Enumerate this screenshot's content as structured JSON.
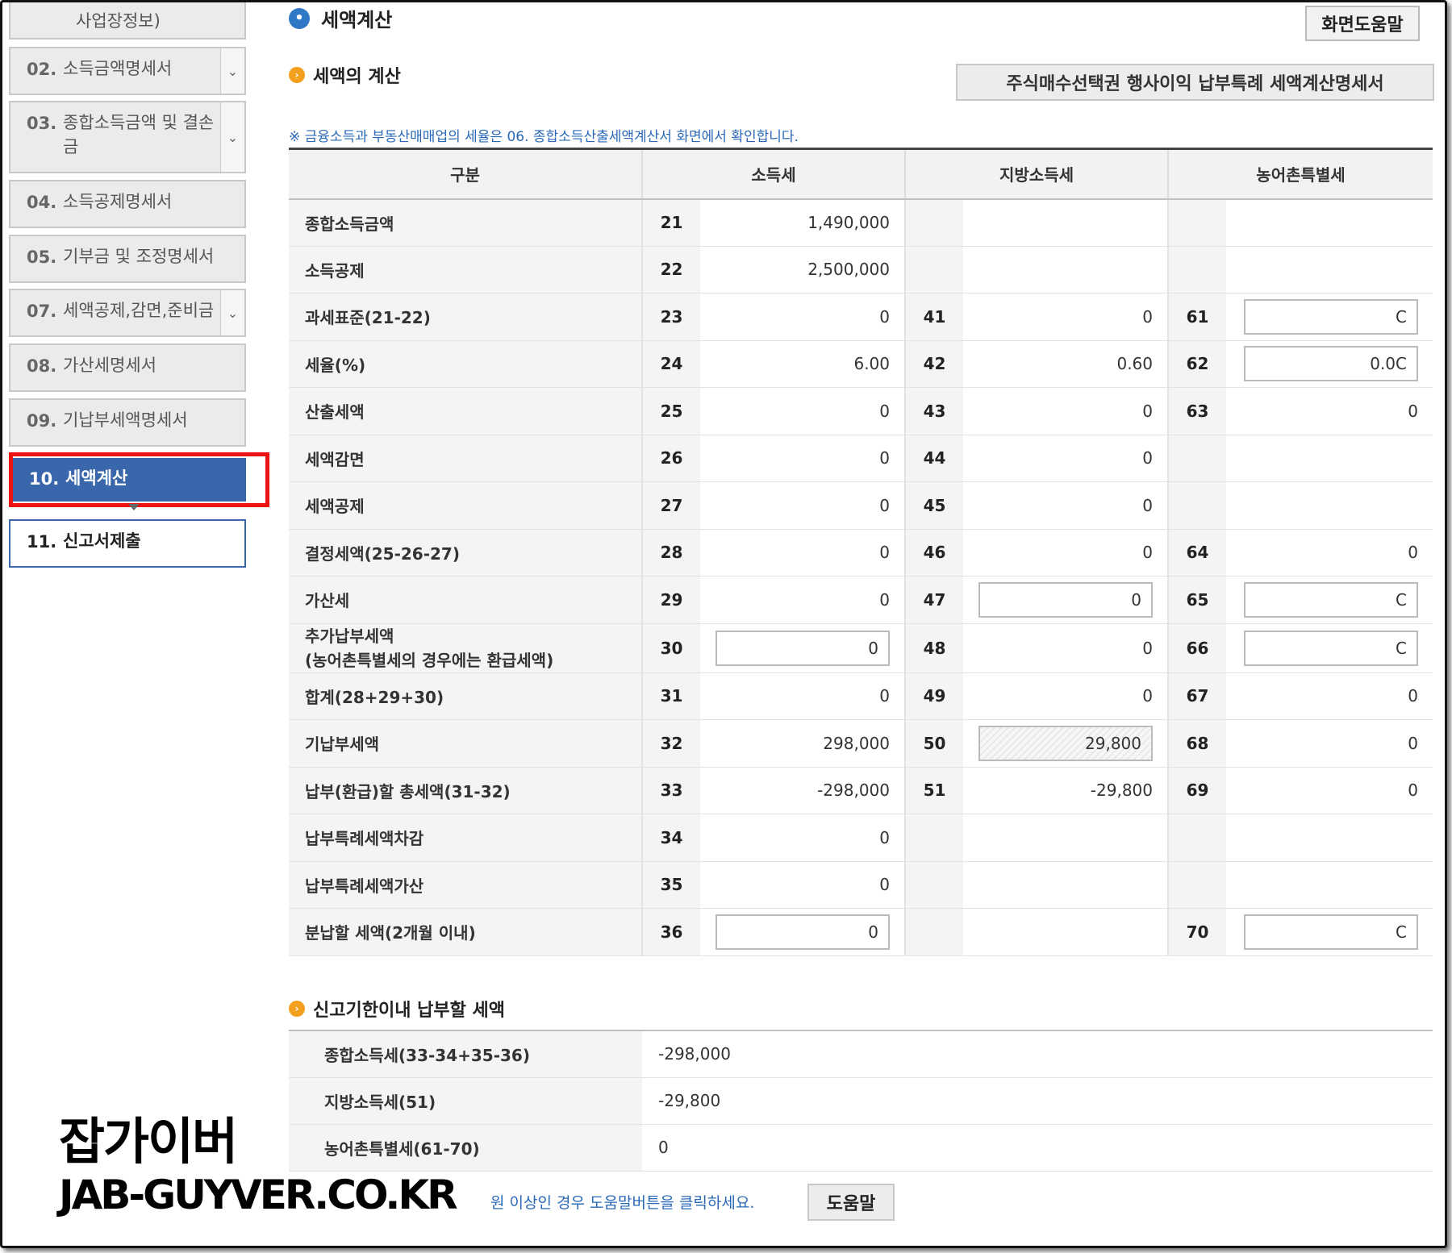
{
  "sidebar": {
    "items": [
      {
        "num": "",
        "label": "사업장정보)"
      },
      {
        "num": "02.",
        "label": "소득금액명세서"
      },
      {
        "num": "03.",
        "label": "종합소득금액 및 결손금"
      },
      {
        "num": "04.",
        "label": "소득공제명세서"
      },
      {
        "num": "05.",
        "label": "기부금 및 조정명세서"
      },
      {
        "num": "07.",
        "label": "세액공제,감면,준비금"
      },
      {
        "num": "08.",
        "label": "가산세명세서"
      },
      {
        "num": "09.",
        "label": "기납부세액명세서"
      },
      {
        "num": "10.",
        "label": "세액계산"
      },
      {
        "num": "11.",
        "label": "신고서제출"
      }
    ]
  },
  "header": {
    "title": "세액계산",
    "help_button": "화면도움말",
    "section_title": "세액의 계산",
    "stock_button": "주식매수선택권 행사이익 납부특례 세액계산명세서",
    "notice": "※ 금융소득과 부동산매매업의 세율은 06. 종합소득산출세액계산서 화면에서 확인합니다."
  },
  "table": {
    "headers": [
      "구분",
      "소득세",
      "지방소득세",
      "농어촌특별세"
    ],
    "rows": [
      {
        "label": "종합소득금액",
        "c1": "21",
        "v1": "1,490,000",
        "c2": "",
        "v2": "",
        "c3": "",
        "v3": ""
      },
      {
        "label": "소득공제",
        "c1": "22",
        "v1": "2,500,000",
        "c2": "",
        "v2": "",
        "c3": "",
        "v3": ""
      },
      {
        "label": "과세표준(21-22)",
        "c1": "23",
        "v1": "0",
        "c2": "41",
        "v2": "0",
        "c3": "61",
        "v3": "C"
      },
      {
        "label": "세율(%)",
        "c1": "24",
        "v1": "6.00",
        "c2": "42",
        "v2": "0.60",
        "c3": "62",
        "v3": "0.0C"
      },
      {
        "label": "산출세액",
        "c1": "25",
        "v1": "0",
        "c2": "43",
        "v2": "0",
        "c3": "63",
        "v3": "0"
      },
      {
        "label": "세액감면",
        "c1": "26",
        "v1": "0",
        "c2": "44",
        "v2": "0",
        "c3": "",
        "v3": ""
      },
      {
        "label": "세액공제",
        "c1": "27",
        "v1": "0",
        "c2": "45",
        "v2": "0",
        "c3": "",
        "v3": ""
      },
      {
        "label": "결정세액(25-26-27)",
        "c1": "28",
        "v1": "0",
        "c2": "46",
        "v2": "0",
        "c3": "64",
        "v3": "0"
      },
      {
        "label": "가산세",
        "c1": "29",
        "v1": "0",
        "c2": "47",
        "v2": "0",
        "c3": "65",
        "v3": "C"
      },
      {
        "label": "추가납부세액",
        "label2": "(농어촌특별세의 경우에는 환급세액)",
        "c1": "30",
        "v1": "0",
        "c2": "48",
        "v2": "0",
        "c3": "66",
        "v3": "C"
      },
      {
        "label": "합계(28+29+30)",
        "c1": "31",
        "v1": "0",
        "c2": "49",
        "v2": "0",
        "c3": "67",
        "v3": "0"
      },
      {
        "label": "기납부세액",
        "c1": "32",
        "v1": "298,000",
        "c2": "50",
        "v2": "29,800",
        "c3": "68",
        "v3": "0"
      },
      {
        "label": "납부(환급)할 총세액(31-32)",
        "c1": "33",
        "v1": "-298,000",
        "c2": "51",
        "v2": "-29,800",
        "c3": "69",
        "v3": "0"
      },
      {
        "label": "납부특례세액차감",
        "c1": "34",
        "v1": "0",
        "c2": "",
        "v2": "",
        "c3": "",
        "v3": ""
      },
      {
        "label": "납부특례세액가산",
        "c1": "35",
        "v1": "0",
        "c2": "",
        "v2": "",
        "c3": "",
        "v3": ""
      },
      {
        "label": "분납할 세액(2개월 이내)",
        "c1": "36",
        "v1": "0",
        "c2": "",
        "v2": "",
        "c3": "70",
        "v3": "C"
      }
    ]
  },
  "deadline": {
    "title": "신고기한이내 납부할 세액",
    "rows": [
      {
        "label": "종합소득세(33-34+35-36)",
        "value": "-298,000"
      },
      {
        "label": "지방소득세(51)",
        "value": "-29,800"
      },
      {
        "label": "농어촌특별세(61-70)",
        "value": "0"
      }
    ]
  },
  "footer": {
    "note": "원 이상인 경우 도움말버튼을 클릭하세요.",
    "help_button": "도움말"
  },
  "watermark": {
    "line1": "잡가이버",
    "line2": "JAB-GUYVER.CO.KR"
  },
  "colors": {
    "active_nav": "#3a66ac",
    "highlight_border": "#ee1111",
    "link_blue": "#2a68b7",
    "bullet_orange": "#f2a01e"
  }
}
